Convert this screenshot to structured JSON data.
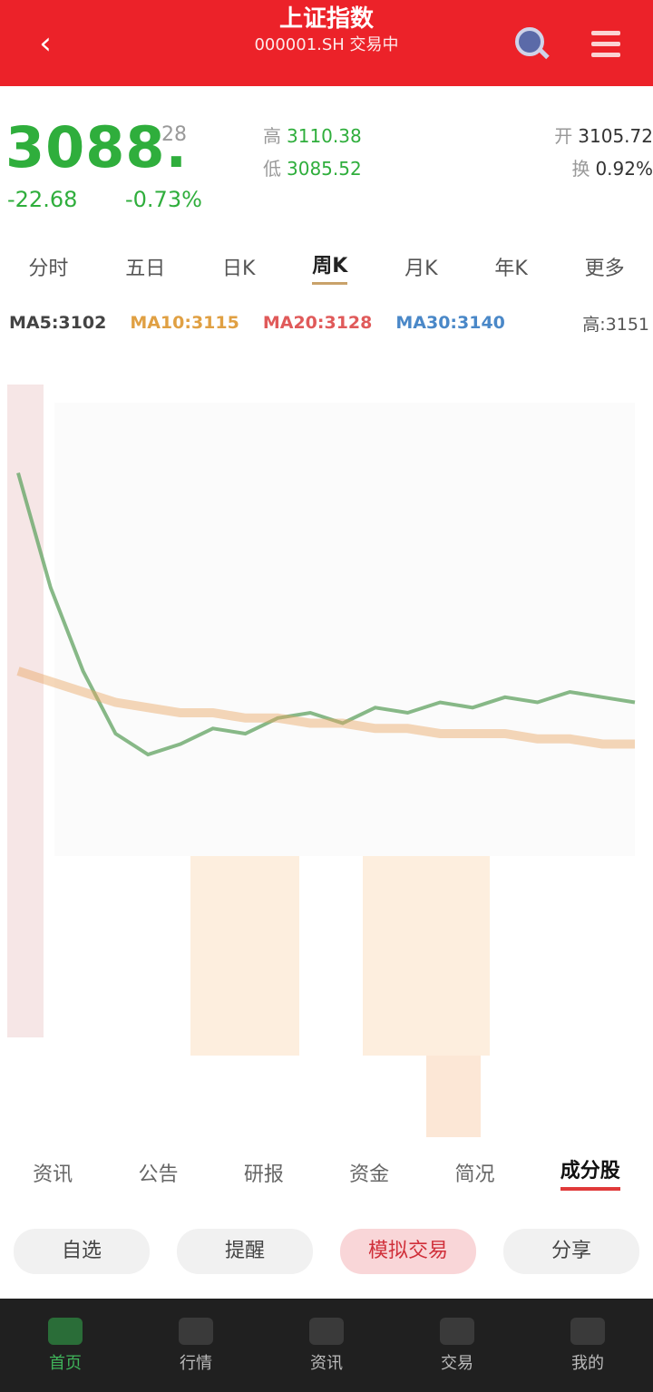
{
  "header": {
    "back_icon": "back-arrow-icon",
    "title": "上证指数",
    "subtitle": "000001.SH 交易中",
    "search_icon": "search-icon",
    "more_icon": "menu-icon"
  },
  "quote": {
    "price": "3088.",
    "change": "-22.68",
    "pct": "-0.73%",
    "side": "28",
    "stats": [
      {
        "label": "高",
        "value": "3110.38"
      },
      {
        "label": "开",
        "value": "3105.72"
      },
      {
        "label": "低",
        "value": "3085.52"
      },
      {
        "label": "换",
        "value": "0.92%"
      }
    ]
  },
  "periods": [
    "分时",
    "五日",
    "日K",
    "周K",
    "月K",
    "年K",
    "更多"
  ],
  "ma": {
    "ma5": "MA5:3102",
    "ma10": "MA10:3115",
    "ma20": "MA20:3128",
    "ma30": "MA30:3140",
    "high": "高:3151"
  },
  "chart_data": {
    "type": "line",
    "title": "",
    "xlabel": "",
    "ylabel": "",
    "x": [
      1,
      2,
      3,
      4,
      5,
      6,
      7,
      8,
      9,
      10,
      11,
      12,
      13,
      14,
      15,
      16,
      17,
      18,
      19,
      20
    ],
    "series": [
      {
        "values": [
          3150,
          3128,
          3112,
          3100,
          3096,
          3098,
          3101,
          3100,
          3103,
          3104,
          3102,
          3105,
          3104,
          3106,
          3105,
          3107,
          3106,
          3108,
          3107,
          3106
        ]
      },
      {
        "values": [
          3112,
          3110,
          3108,
          3106,
          3105,
          3104,
          3104,
          3103,
          3103,
          3102,
          3102,
          3101,
          3101,
          3100,
          3100,
          3100,
          3099,
          3099,
          3098,
          3098
        ]
      }
    ],
    "ylim": [
      3080,
      3160
    ],
    "colors": {
      "price": "#6aa86a",
      "avg": "#e9a763",
      "pink": "#f3c6c6"
    }
  },
  "tabs_bottom": [
    "资讯",
    "公告",
    "研报",
    "资金",
    "简况",
    "成分股"
  ],
  "actions": [
    "自选",
    "提醒",
    "模拟交易",
    "分享"
  ],
  "nav": [
    "首页",
    "行情",
    "资讯",
    "交易",
    "我的"
  ]
}
